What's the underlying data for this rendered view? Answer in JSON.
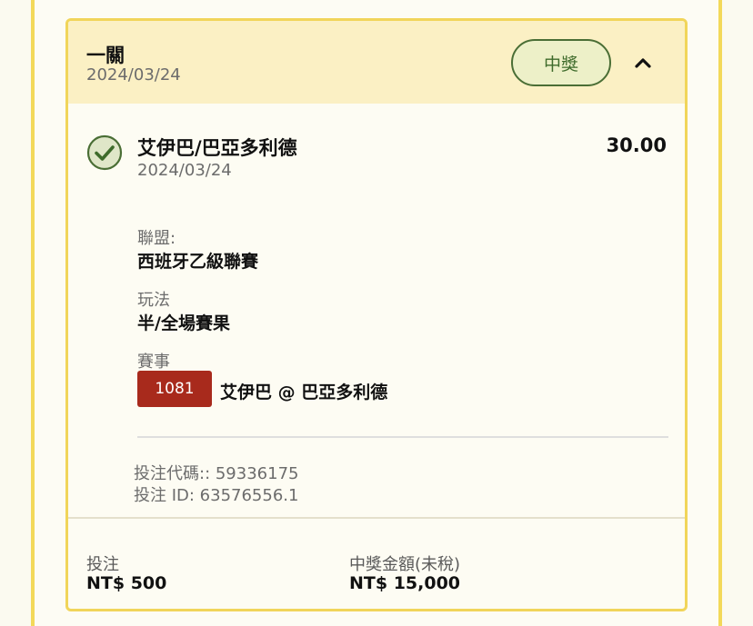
{
  "header": {
    "title": "一關",
    "date": "2024/03/24",
    "status_badge": "中獎",
    "collapse_icon": "chevron-up-icon"
  },
  "selection": {
    "name": "艾伊巴/巴亞多利德",
    "date": "2024/03/24",
    "odds": "30.00",
    "status_icon": "check-circle-icon",
    "league_label": "聯盟:",
    "league_value": "西班牙乙級聯賽",
    "market_label": "玩法",
    "market_value": "半/全場賽果",
    "event_label": "賽事",
    "event_code": "1081",
    "event_name": "艾伊巴 @ 巴亞多利德"
  },
  "bet_info": {
    "code_line": "投注代碼:: 59336175",
    "id_line": "投注 ID: 63576556.1"
  },
  "footer": {
    "stake_label": "投注",
    "stake_value": "NT$ 500",
    "payout_label": "中獎金額(未稅)",
    "payout_value": "NT$ 15,000"
  },
  "colors": {
    "accent_border": "#f1d55a",
    "header_bg": "#fbf0c4",
    "badge_green": "#3e6b2b",
    "event_code_red": "#a82a1c"
  }
}
